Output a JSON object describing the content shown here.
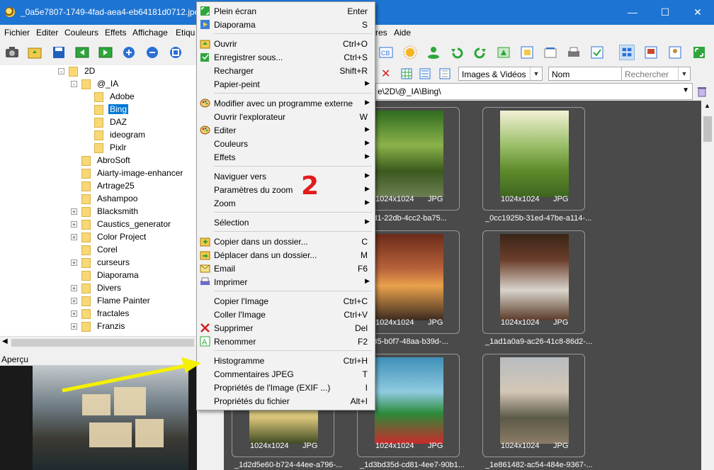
{
  "window": {
    "title": "_0a5e7807-1749-4fad-aea4-eb64181d0712.jpeg",
    "controls": [
      "—",
      "☐",
      "✕"
    ]
  },
  "menubar": {
    "items": [
      "Fichier",
      "Editer",
      "Couleurs",
      "Effets",
      "Affichage",
      "Etiqu",
      "res",
      "Aide"
    ]
  },
  "tree": {
    "nodes": [
      {
        "label": "2D",
        "level": 0,
        "expander": "-"
      },
      {
        "label": "@_IA",
        "level": 1,
        "expander": "-"
      },
      {
        "label": "Adobe",
        "level": 2,
        "expander": ""
      },
      {
        "label": "Bing",
        "level": 2,
        "expander": "",
        "selected": true
      },
      {
        "label": "DAZ",
        "level": 2,
        "expander": ""
      },
      {
        "label": "ideogram",
        "level": 2,
        "expander": ""
      },
      {
        "label": "Pixlr",
        "level": 2,
        "expander": ""
      },
      {
        "label": "AbroSoft",
        "level": 1,
        "expander": ""
      },
      {
        "label": "Aiarty-image-enhancer",
        "level": 1,
        "expander": ""
      },
      {
        "label": "Artrage25",
        "level": 1,
        "expander": ""
      },
      {
        "label": "Ashampoo",
        "level": 1,
        "expander": ""
      },
      {
        "label": "Blacksmith",
        "level": 1,
        "expander": "+"
      },
      {
        "label": "Caustics_generator",
        "level": 1,
        "expander": "+"
      },
      {
        "label": "Color Project",
        "level": 1,
        "expander": "+"
      },
      {
        "label": "Corel",
        "level": 1,
        "expander": ""
      },
      {
        "label": "curseurs",
        "level": 1,
        "expander": "+"
      },
      {
        "label": "Diaporama",
        "level": 1,
        "expander": ""
      },
      {
        "label": "Divers",
        "level": 1,
        "expander": "+"
      },
      {
        "label": "Flame Painter",
        "level": 1,
        "expander": "+"
      },
      {
        "label": "fractales",
        "level": 1,
        "expander": "+"
      },
      {
        "label": "Franzis",
        "level": 1,
        "expander": "+"
      }
    ]
  },
  "preview": {
    "label": "Aperçu"
  },
  "browser": {
    "filter": "Images & Vidéos",
    "sort": "Nom",
    "search_placeholder": "Rechercher",
    "path": "e\\2D\\@_IA\\Bing\\",
    "thumbnails": [
      {
        "res": "1024x1024",
        "fmt": "JPG",
        "name": "3bed1-22db-4cc2-ba75..."
      },
      {
        "res": "1024x1024",
        "fmt": "JPG",
        "name": "_0cc1925b-31ed-47be-a114-..."
      },
      {
        "res": "1024x1024",
        "fmt": "JPG",
        "name": "9ab35-b0f7-48aa-b39d-..."
      },
      {
        "res": "1024x1024",
        "fmt": "JPG",
        "name": "_1ad1a0a9-ac26-41c8-86d2-..."
      },
      {
        "res": "1024x1024",
        "fmt": "JPG",
        "name": "_1d2d5e60-b724-44ee-a796-..."
      },
      {
        "res": "1024x1024",
        "fmt": "JPG",
        "name": "_1d3bd35d-cd81-4ee7-90b1..."
      },
      {
        "res": "1024x1024",
        "fmt": "JPG",
        "name": "_1e861482-ac54-484e-9367-..."
      }
    ]
  },
  "context_menu": {
    "items": [
      {
        "label": "Plein écran",
        "shortcut": "Enter",
        "icon": "fullscreen-icon",
        "submenu": false
      },
      {
        "label": "Diaporama",
        "shortcut": "S",
        "icon": "slideshow-icon",
        "submenu": false
      },
      {
        "label": "Ouvrir",
        "shortcut": "Ctrl+O",
        "icon": "open-folder-icon",
        "submenu": false
      },
      {
        "label": "Enregistrer sous...",
        "shortcut": "Ctrl+S",
        "icon": "save-as-icon",
        "submenu": false
      },
      {
        "label": "Recharger",
        "shortcut": "Shift+R",
        "icon": "",
        "submenu": false
      },
      {
        "label": "Papier-peint",
        "shortcut": "",
        "icon": "",
        "submenu": true
      },
      {
        "label": "Modifier avec un programme externe",
        "shortcut": "",
        "icon": "palette-icon",
        "submenu": true
      },
      {
        "label": "Ouvrir l'explorateur",
        "shortcut": "W",
        "icon": "",
        "submenu": false
      },
      {
        "label": "Editer",
        "shortcut": "",
        "icon": "palette-icon",
        "submenu": true
      },
      {
        "label": "Couleurs",
        "shortcut": "",
        "icon": "",
        "submenu": true
      },
      {
        "label": "Effets",
        "shortcut": "",
        "icon": "",
        "submenu": true
      },
      {
        "label": "Naviguer vers",
        "shortcut": "",
        "icon": "",
        "submenu": true
      },
      {
        "label": "Paramètres du zoom",
        "shortcut": "",
        "icon": "",
        "submenu": true
      },
      {
        "label": "Zoom",
        "shortcut": "",
        "icon": "",
        "submenu": true
      },
      {
        "label": "Sélection",
        "shortcut": "",
        "icon": "",
        "submenu": true
      },
      {
        "label": "Copier dans un dossier...",
        "shortcut": "C",
        "icon": "copy-folder-icon",
        "submenu": false
      },
      {
        "label": "Déplacer dans un dossier...",
        "shortcut": "M",
        "icon": "move-folder-icon",
        "submenu": false
      },
      {
        "label": "Email",
        "shortcut": "F6",
        "icon": "email-icon",
        "submenu": false
      },
      {
        "label": "Imprimer",
        "shortcut": "",
        "icon": "print-icon",
        "submenu": true
      },
      {
        "label": "Copier l'Image",
        "shortcut": "Ctrl+C",
        "icon": "",
        "submenu": false
      },
      {
        "label": "Coller l'Image",
        "shortcut": "Ctrl+V",
        "icon": "",
        "submenu": false
      },
      {
        "label": "Supprimer",
        "shortcut": "Del",
        "icon": "delete-icon",
        "submenu": false
      },
      {
        "label": "Renommer",
        "shortcut": "F2",
        "icon": "rename-icon",
        "submenu": false
      },
      {
        "label": "Histogramme",
        "shortcut": "Ctrl+H",
        "icon": "",
        "submenu": false
      },
      {
        "label": "Commentaires JPEG",
        "shortcut": "T",
        "icon": "",
        "submenu": false
      },
      {
        "label": "Propriétés de l'Image (EXIF ...)",
        "shortcut": "I",
        "icon": "",
        "submenu": false
      },
      {
        "label": "Propriétés du fichier",
        "shortcut": "Alt+I",
        "icon": "",
        "submenu": false
      }
    ]
  },
  "annotation": {
    "number": "2",
    "arrow_color": "#f5f000",
    "number_color": "#e21c1c"
  }
}
